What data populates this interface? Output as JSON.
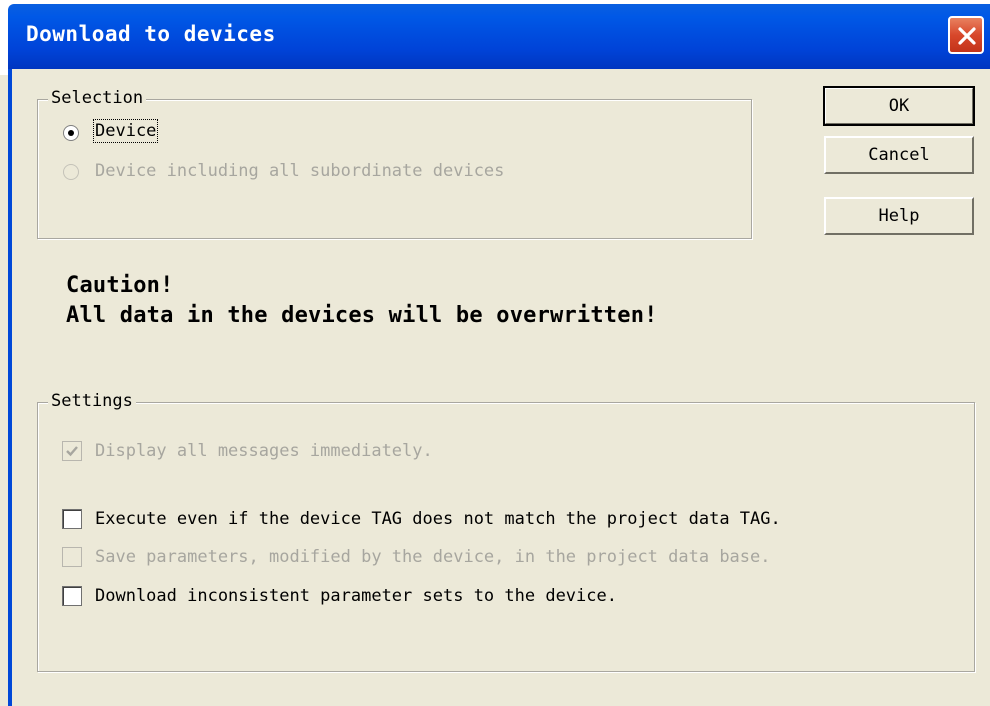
{
  "window": {
    "title": "Download to devices"
  },
  "selection": {
    "legend": "Selection",
    "options": [
      {
        "label": "Device",
        "selected": true,
        "enabled": true
      },
      {
        "label": "Device including all subordinate devices",
        "selected": false,
        "enabled": false
      }
    ]
  },
  "buttons": {
    "ok": "OK",
    "cancel": "Cancel",
    "help": "Help"
  },
  "caution": {
    "line1": "Caution!",
    "line2": "All data in the devices will be overwritten!"
  },
  "settings": {
    "legend": "Settings",
    "options": [
      {
        "label": "Display all messages immediately.",
        "checked": true,
        "enabled": false
      },
      {
        "label": "Execute even if the device TAG does not match the project data TAG.",
        "checked": false,
        "enabled": true
      },
      {
        "label": "Save parameters, modified by the device, in the project data base.",
        "checked": false,
        "enabled": false
      },
      {
        "label": "Download inconsistent parameter sets to the device.",
        "checked": false,
        "enabled": true
      }
    ]
  },
  "icons": {
    "close": "close-icon",
    "checkmark": "checkmark-icon"
  }
}
